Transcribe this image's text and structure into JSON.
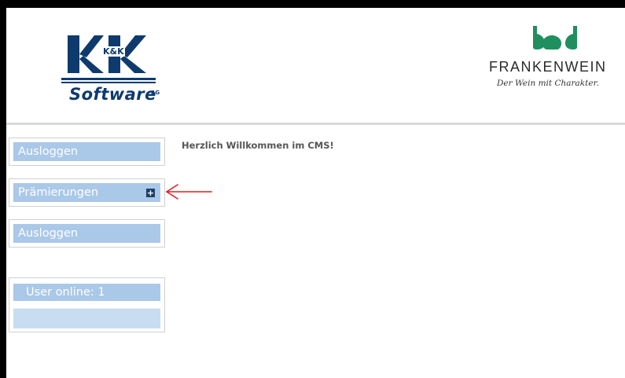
{
  "header": {
    "left_logo": {
      "mark": "K&K",
      "wordmark": "Software",
      "suffix": "AG"
    },
    "right_logo": {
      "name": "FRANKENWEIN",
      "slogan": "Der Wein mit Charakter."
    }
  },
  "sidebar": {
    "top_logout_label": "Ausloggen",
    "menu": {
      "label": "Prämierungen",
      "expand_icon": "plus-icon"
    },
    "bottom_logout_label": "Ausloggen",
    "online": {
      "label": "User online: 1"
    }
  },
  "main": {
    "welcome_text": "Herzlich Willkommen im CMS!"
  },
  "annotation": {
    "arrow_color": "#e01e1e"
  },
  "colors": {
    "nav_button_bg": "#aac8e8",
    "logo_blue": "#0e3a6e",
    "frankenwein_green": "#1f8f5f"
  }
}
